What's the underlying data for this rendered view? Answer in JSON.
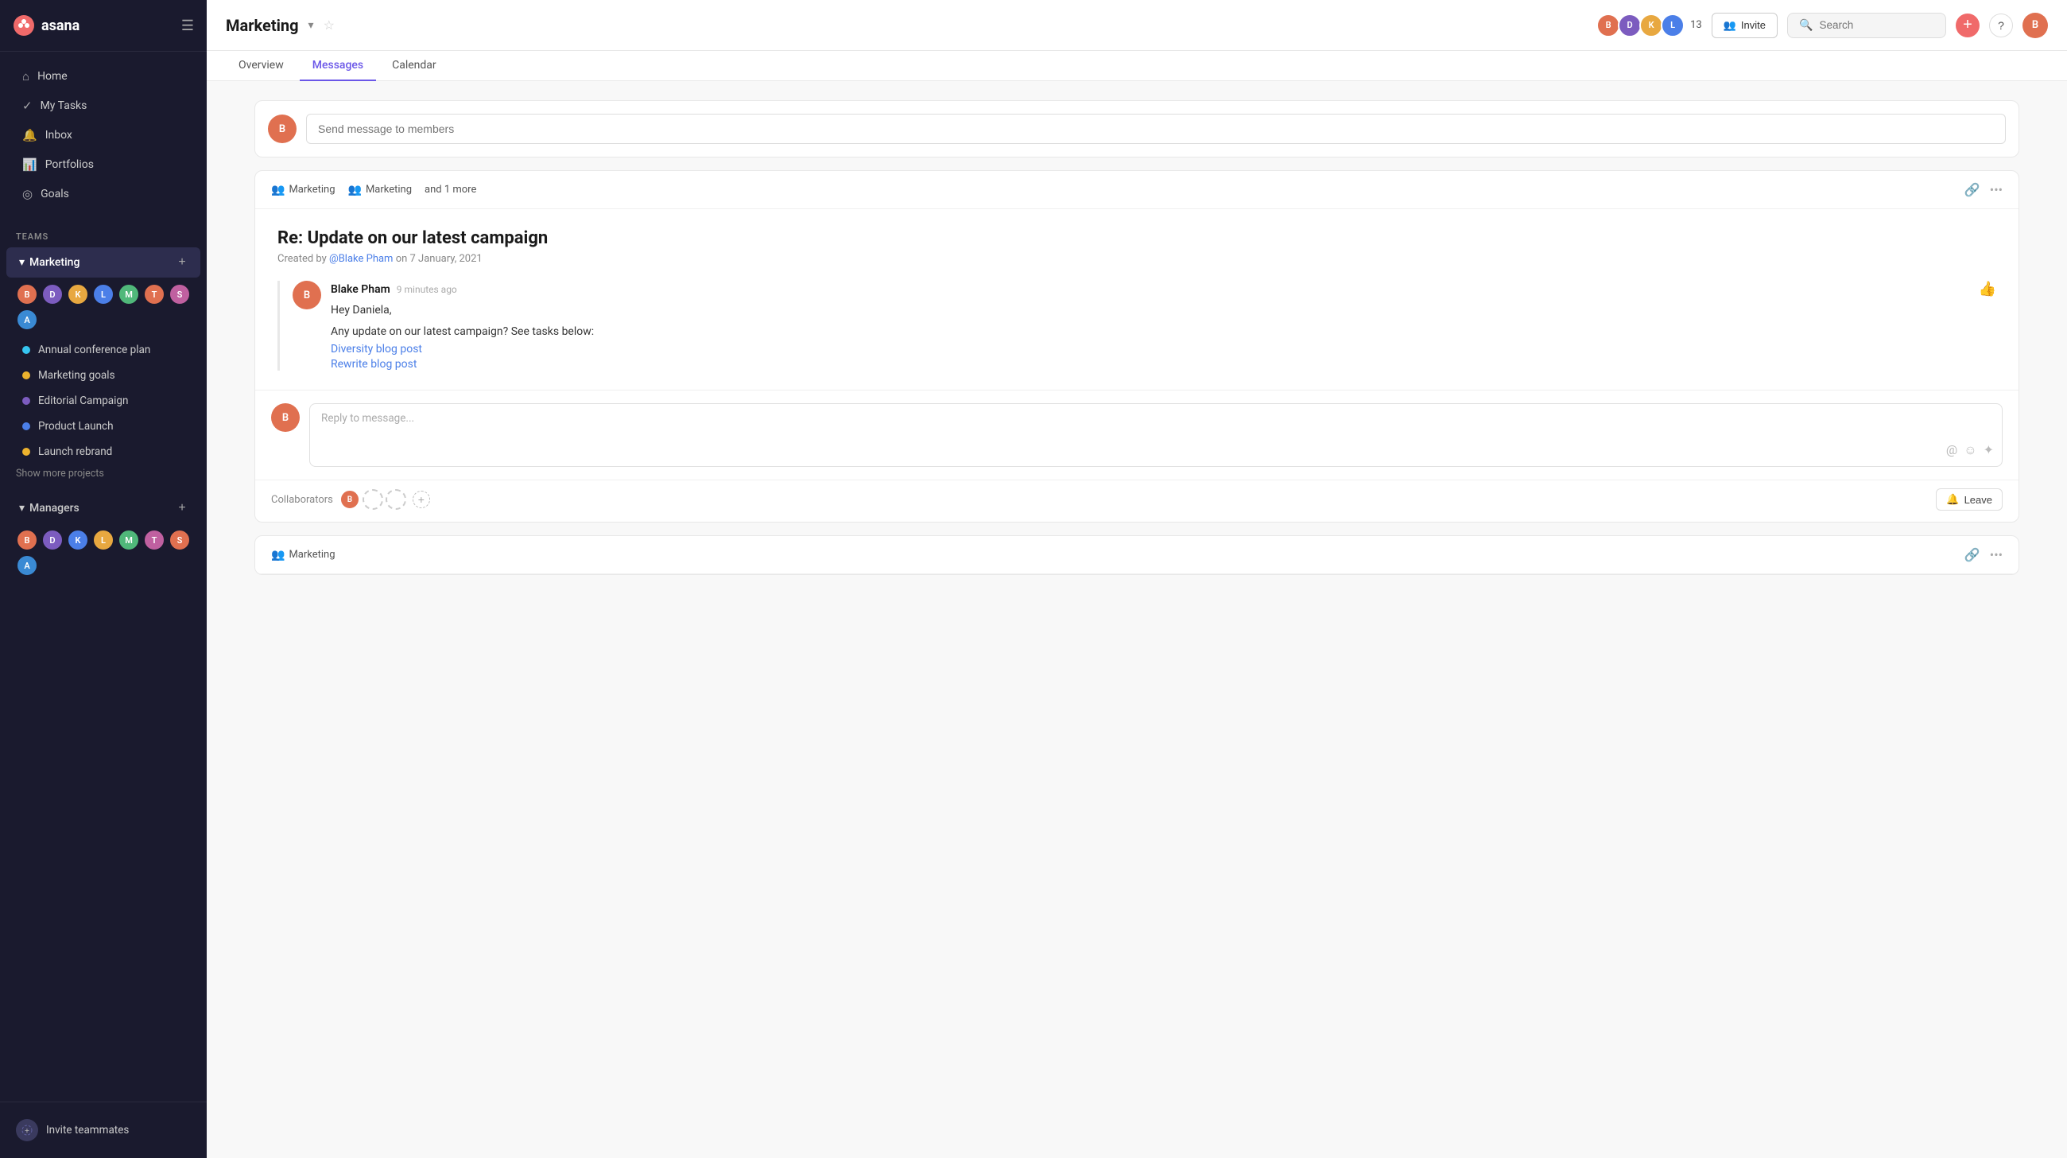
{
  "sidebar": {
    "logo": "asana",
    "toggle_icon": "☰",
    "nav": [
      {
        "id": "home",
        "label": "Home",
        "icon": "⌂"
      },
      {
        "id": "my-tasks",
        "label": "My Tasks",
        "icon": "✓"
      },
      {
        "id": "inbox",
        "label": "Inbox",
        "icon": "🔔"
      },
      {
        "id": "portfolios",
        "label": "Portfolios",
        "icon": "📊"
      },
      {
        "id": "goals",
        "label": "Goals",
        "icon": "◎"
      }
    ],
    "teams_label": "Teams",
    "marketing_team": {
      "name": "Marketing",
      "projects": [
        {
          "id": "annual-conference",
          "label": "Annual conference plan",
          "dot_color": "#36c5f0"
        },
        {
          "id": "marketing-goals",
          "label": "Marketing goals",
          "dot_color": "#ecb22e"
        },
        {
          "id": "editorial-campaign",
          "label": "Editorial Campaign",
          "dot_color": "#7c5cbf"
        },
        {
          "id": "product-launch",
          "label": "Product Launch",
          "dot_color": "#4b7fe8"
        },
        {
          "id": "launch-rebrand",
          "label": "Launch rebrand",
          "dot_color": "#ecb22e"
        }
      ],
      "show_more": "Show more projects"
    },
    "managers_team": {
      "name": "Managers"
    },
    "invite_teammates": "Invite teammates"
  },
  "header": {
    "project_title": "Marketing",
    "chevron_icon": "▾",
    "star_icon": "☆",
    "member_count": "13",
    "invite_label": "Invite",
    "search_placeholder": "Search",
    "tabs": [
      {
        "id": "overview",
        "label": "Overview"
      },
      {
        "id": "messages",
        "label": "Messages",
        "active": true
      },
      {
        "id": "calendar",
        "label": "Calendar"
      }
    ]
  },
  "compose": {
    "placeholder": "Send message to members"
  },
  "message_card": {
    "tags": [
      {
        "label": "Marketing"
      },
      {
        "label": "Marketing"
      },
      {
        "label": "and 1 more"
      }
    ],
    "title": "Re: Update on our latest campaign",
    "created_by": "Created by",
    "mention": "@Blake Pham",
    "date": "on 7 January, 2021",
    "thread": {
      "author": "Blake Pham",
      "time": "9 minutes ago",
      "greeting": "Hey Daniela,",
      "body": "Any update on our latest campaign? See tasks below:",
      "links": [
        {
          "label": "Diversity blog post"
        },
        {
          "label": "Rewrite blog post"
        }
      ]
    },
    "reply_placeholder": "Reply to message...",
    "collaborators_label": "Collaborators",
    "leave_label": "Leave",
    "bell_icon": "🔔"
  },
  "message_card2": {
    "tag": "Marketing"
  },
  "icons": {
    "chevron_down": "▾",
    "link": "🔗",
    "more": "•••",
    "like": "👍",
    "at": "@",
    "emoji": "☺",
    "star2": "✦",
    "add": "+",
    "search": "🔍",
    "help": "?",
    "people": "👥",
    "bell": "🔔"
  }
}
